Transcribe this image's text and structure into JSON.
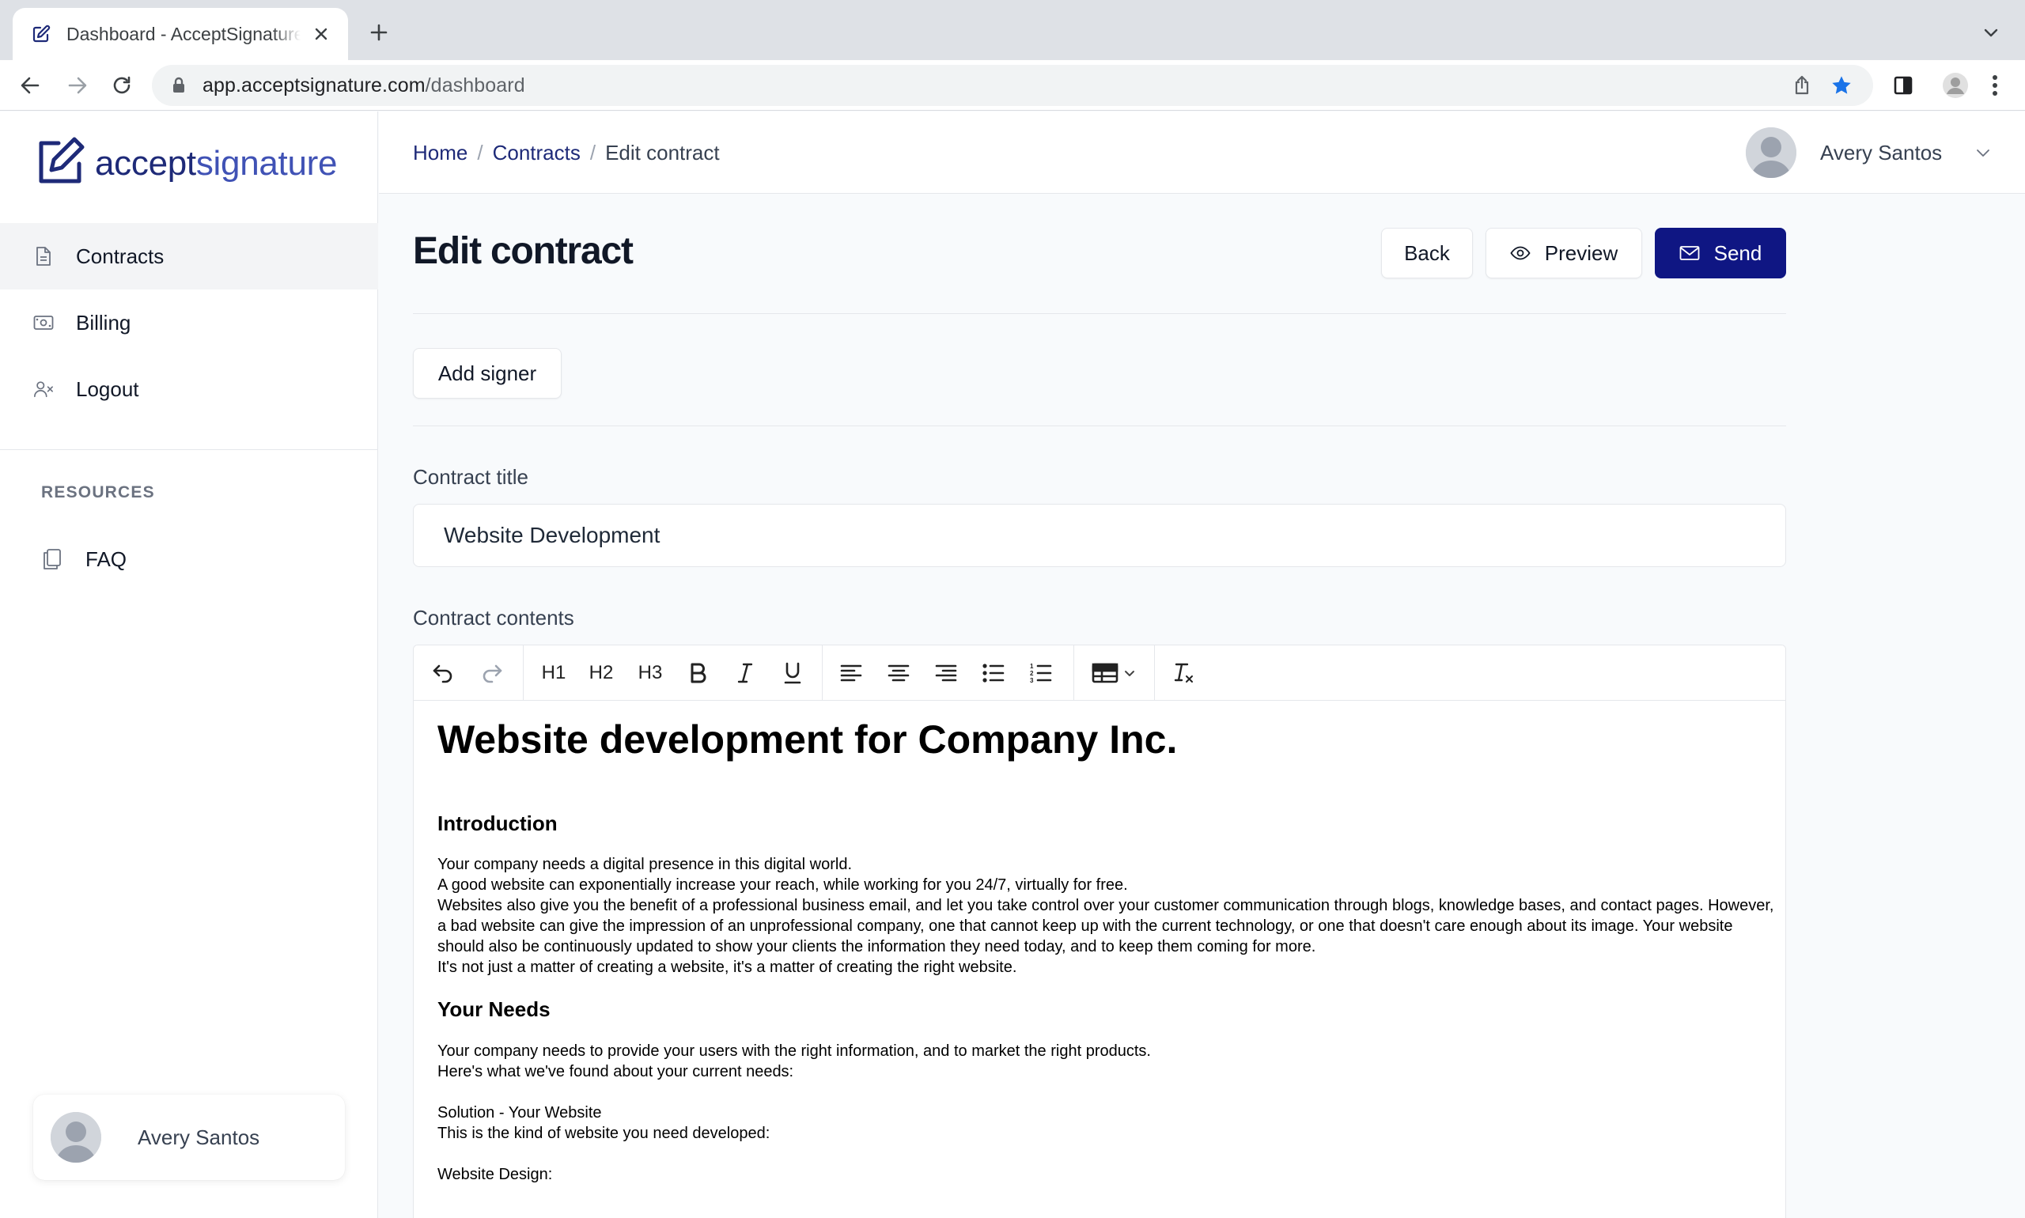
{
  "browser": {
    "tab_title": "Dashboard - AcceptSignature.com",
    "url_host": "app.acceptsignature.com",
    "url_path": "/dashboard"
  },
  "sidebar": {
    "logo_accept": "accept",
    "logo_signature": "signature",
    "items": [
      {
        "label": "Contracts",
        "icon": "document-icon"
      },
      {
        "label": "Billing",
        "icon": "banknote-icon"
      },
      {
        "label": "Logout",
        "icon": "user-x-icon"
      }
    ],
    "resources_heading": "RESOURCES",
    "resources": [
      {
        "label": "FAQ",
        "icon": "copy-icon"
      }
    ],
    "user_name": "Avery Santos"
  },
  "header": {
    "breadcrumb": [
      "Home",
      "Contracts",
      "Edit contract"
    ],
    "user_name": "Avery Santos"
  },
  "page": {
    "title": "Edit contract",
    "back_label": "Back",
    "preview_label": "Preview",
    "send_label": "Send",
    "add_signer_label": "Add signer",
    "contract_title_label": "Contract title",
    "contract_title_value": "Website Development",
    "contract_contents_label": "Contract contents"
  },
  "editor": {
    "toolbar": {
      "h1": "H1",
      "h2": "H2",
      "h3": "H3"
    },
    "heading": "Website development for Company Inc.",
    "section1_title": "Introduction",
    "section1_lines": [
      "Your company needs a digital presence in this digital world.",
      "A good website can exponentially increase your reach, while working for you 24/7, virtually for free.",
      "Websites also give you the benefit of a professional business email, and let you take control over your customer communication through blogs, knowledge bases, and contact pages. However, a bad website can give the impression of an unprofessional company, one that cannot keep up with the current technology, or one that doesn't care enough about its image. Your website should also be continuously updated to show your clients the information they need today, and to keep them coming for more.",
      "It's not just a matter of creating a website, it's a matter of creating the right website."
    ],
    "section2_title": "Your Needs",
    "section2_lines": [
      "Your company needs to provide your users with the right information, and to market the right products.",
      "Here's what we've found about your current needs:"
    ],
    "section3_lines": [
      "Solution - Your Website",
      "This is the kind of website you need developed:"
    ],
    "section4_line": "Website Design:"
  },
  "colors": {
    "primary": "#0f1683",
    "logo_dark": "#1e2a78",
    "logo_light": "#4052b5"
  }
}
